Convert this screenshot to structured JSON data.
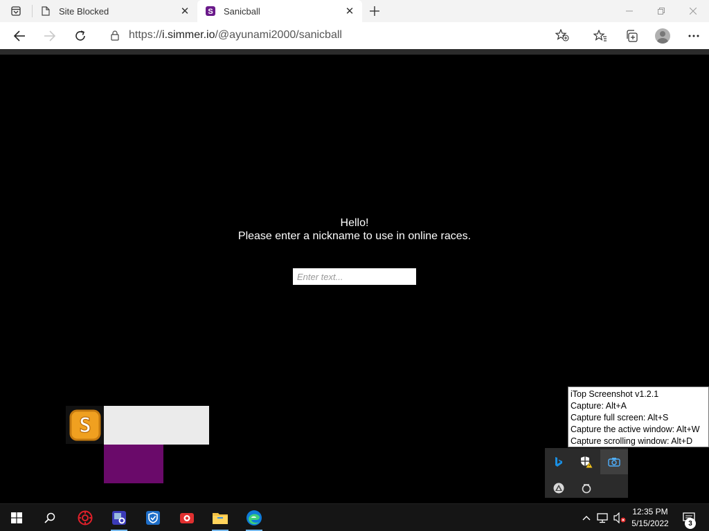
{
  "browser": {
    "tabs": [
      {
        "title": "Site Blocked",
        "favicon": "page-icon",
        "active": false
      },
      {
        "title": "Sanicball",
        "favicon": "sanicball-s-icon",
        "active": true
      }
    ],
    "address": {
      "prefix": "https://",
      "host": "i.simmer.io",
      "path": "/@ayunami2000/sanicball"
    }
  },
  "game": {
    "greeting": "Hello!",
    "prompt": "Please enter a nickname to use in online races.",
    "input_value": "",
    "input_placeholder": "Enter text...",
    "logo_letter": "S"
  },
  "tooltip": {
    "lines": [
      "iTop Screenshot v1.2.1",
      "Capture: Alt+A",
      "Capture full screen: Alt+S",
      "Capture the active window: Alt+W",
      "Capture scrolling window: Alt+D"
    ]
  },
  "taskbar": {
    "time": "12:35 PM",
    "date": "5/15/2022",
    "notification_count": "3"
  },
  "colors": {
    "sanicball_purple": "#6a0a6a",
    "logo_orange": "#f0a020",
    "edge_blue": "#0f7bd8"
  }
}
